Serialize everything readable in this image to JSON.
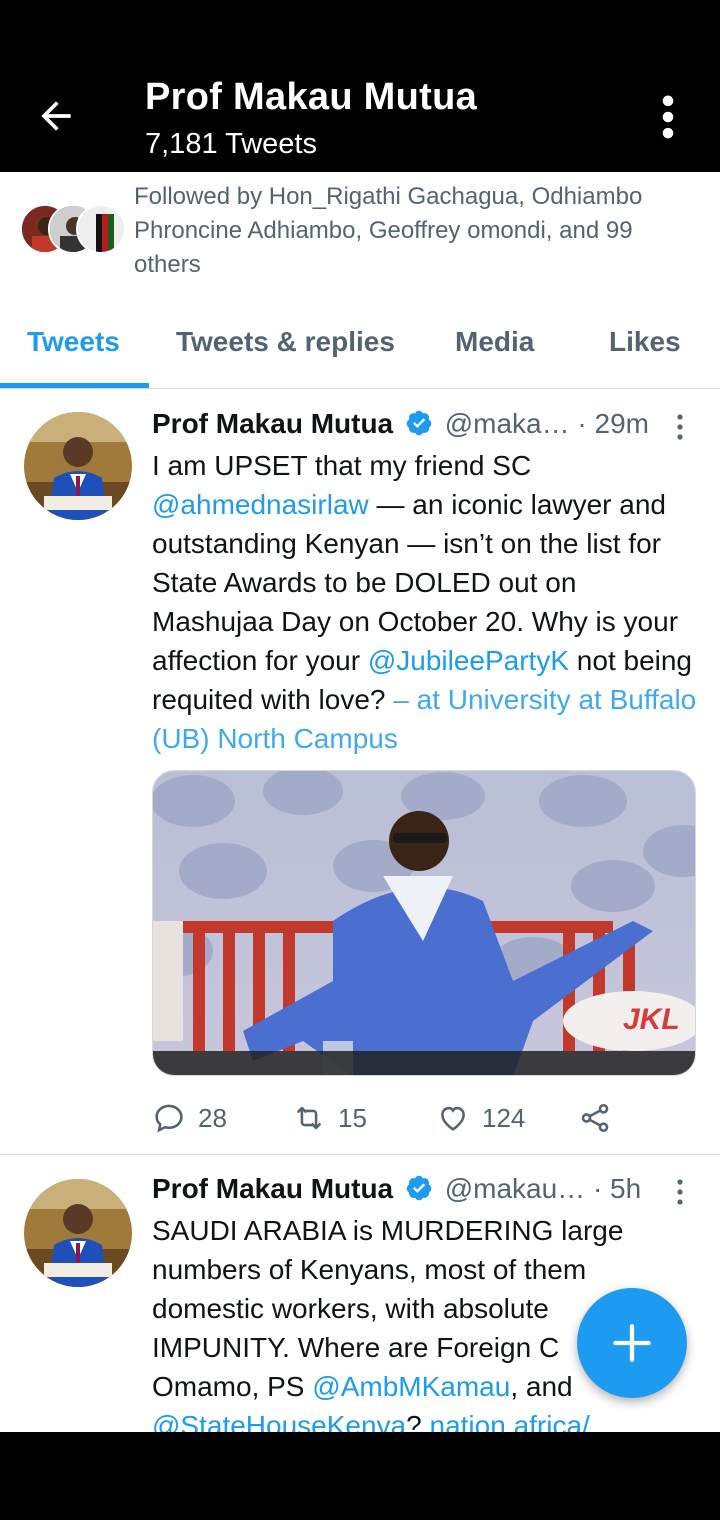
{
  "header": {
    "title": "Prof Makau Mutua",
    "subtitle": "7,181 Tweets",
    "back_icon": "arrow-left-icon",
    "menu_icon": "more-vertical-icon"
  },
  "followed_by": {
    "text": "Followed by Hon_Rigathi Gachagua, Odhiambo Phroncine Adhiambo, Geoffrey omondi, and 99 others"
  },
  "tabs": [
    {
      "label": "Tweets",
      "active": true
    },
    {
      "label": "Tweets & replies",
      "active": false
    },
    {
      "label": "Media",
      "active": false
    },
    {
      "label": "Likes",
      "active": false
    }
  ],
  "tweets": [
    {
      "name": "Prof Makau Mutua",
      "handle": "@maka…",
      "time": "· 29m",
      "body_parts": {
        "p1": "I am UPSET that my friend SC ",
        "m1": "@ahmednasirlaw",
        "p2": " — an iconic lawyer and outstanding Kenyan — isn’t on the list for State Awards to be DOLED out on Mashujaa Day on October 20.  Why is your affection for your ",
        "m2": "@JubileePartyK",
        "p3": " not being requited with love? ",
        "loc": "– at University at Buffalo (UB) North Campus"
      },
      "media_text": "JKL",
      "replies": "28",
      "retweets": "15",
      "likes": "124"
    },
    {
      "name": "Prof Makau Mutua",
      "handle": "@makau…",
      "time": "· 5h",
      "body_parts": {
        "p1": "SAUDI ARABIA is MURDERING large numbers of Kenyans, most of them domestic workers, with absolute IMPUNITY.  Where are Foreign C",
        "p1b": "Omamo, PS ",
        "m1": "@AmbMKamau",
        "p2": ", and ",
        "m2": "@StateHouseKenya",
        "p3": "?  ",
        "link": "nation.africa/"
      }
    }
  ],
  "colors": {
    "accent": "#1d9bf0",
    "secondary_text": "#536471",
    "header_bg": "#000000"
  }
}
